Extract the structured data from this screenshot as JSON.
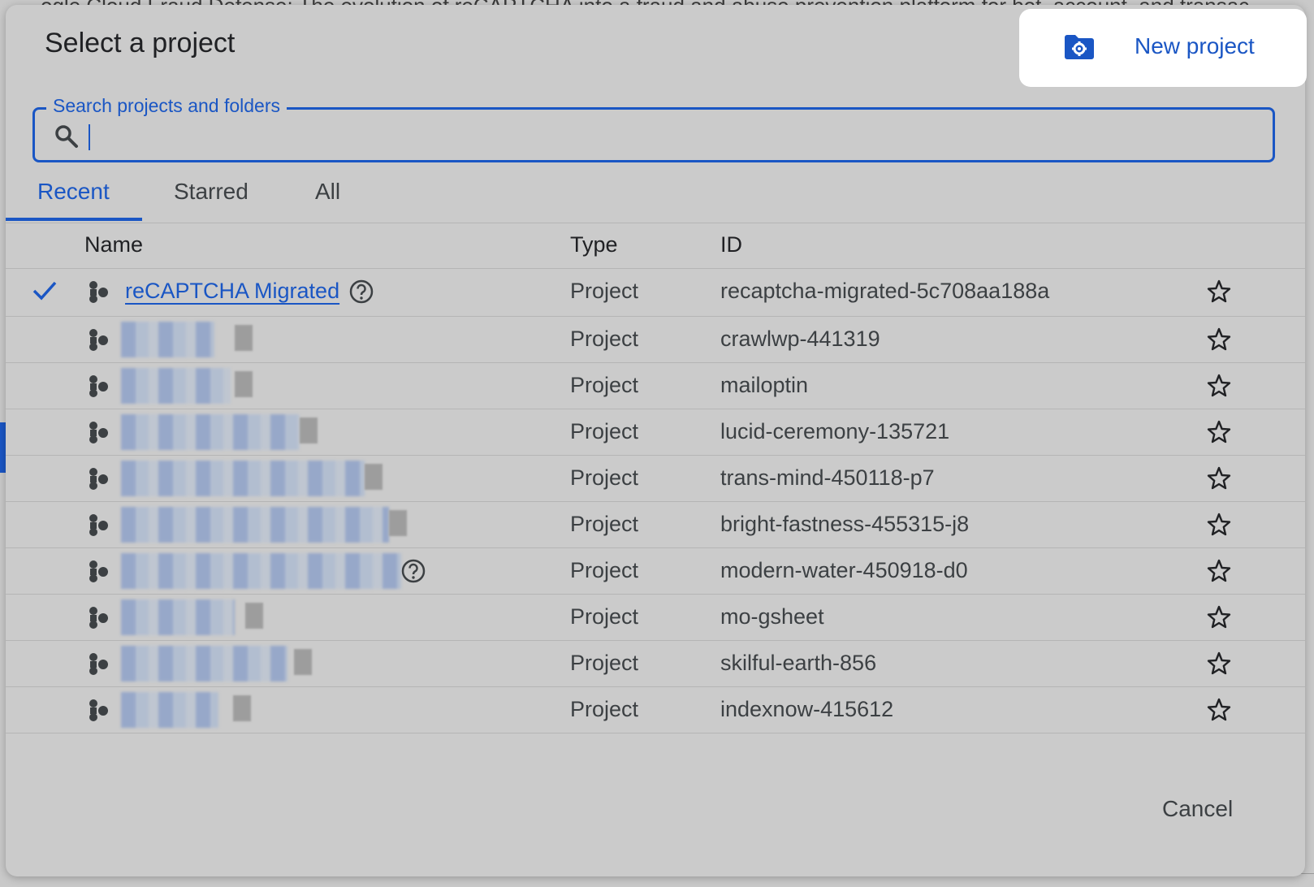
{
  "background": {
    "text": "ogle Cloud Fraud Defense: The evolution of reCAPTCHA into a fraud and abuse prevention platform for bot, account, and transac"
  },
  "dialog": {
    "title": "Select a project",
    "new_project_button": {
      "label": "New project",
      "icon": "folder-settings-icon"
    },
    "search": {
      "label": "Search projects and folders",
      "value": "",
      "icon": "search-icon"
    },
    "tabs": [
      {
        "label": "Recent",
        "active": true
      },
      {
        "label": "Starred",
        "active": false
      },
      {
        "label": "All",
        "active": false
      }
    ],
    "table": {
      "columns": {
        "name": "Name",
        "type": "Type",
        "id": "ID"
      },
      "rows": [
        {
          "selected": true,
          "name": "reCAPTCHA Migrated",
          "name_redacted": false,
          "type": "Project",
          "id": "recaptcha-migrated-5c708aa188a"
        },
        {
          "selected": false,
          "name": "",
          "name_redacted": true,
          "type": "Project",
          "id": "crawlwp-441319"
        },
        {
          "selected": false,
          "name": "",
          "name_redacted": true,
          "type": "Project",
          "id": "mailoptin"
        },
        {
          "selected": false,
          "name": "",
          "name_redacted": true,
          "type": "Project",
          "id": "lucid-ceremony-135721"
        },
        {
          "selected": false,
          "name": "",
          "name_redacted": true,
          "type": "Project",
          "id": "trans-mind-450118-p7"
        },
        {
          "selected": false,
          "name": "",
          "name_redacted": true,
          "type": "Project",
          "id": "bright-fastness-455315-j8"
        },
        {
          "selected": false,
          "name": "",
          "name_redacted": true,
          "type": "Project",
          "id": "modern-water-450918-d0"
        },
        {
          "selected": false,
          "name": "",
          "name_redacted": true,
          "type": "Project",
          "id": "mo-gsheet"
        },
        {
          "selected": false,
          "name": "",
          "name_redacted": true,
          "type": "Project",
          "id": "skilful-earth-856"
        },
        {
          "selected": false,
          "name": "",
          "name_redacted": true,
          "type": "Project",
          "id": "indexnow-415612"
        }
      ]
    },
    "cancel_label": "Cancel"
  },
  "colors": {
    "accent": "#1a56c4",
    "dialog_bg": "#cbcbcb",
    "text": "#202124"
  }
}
